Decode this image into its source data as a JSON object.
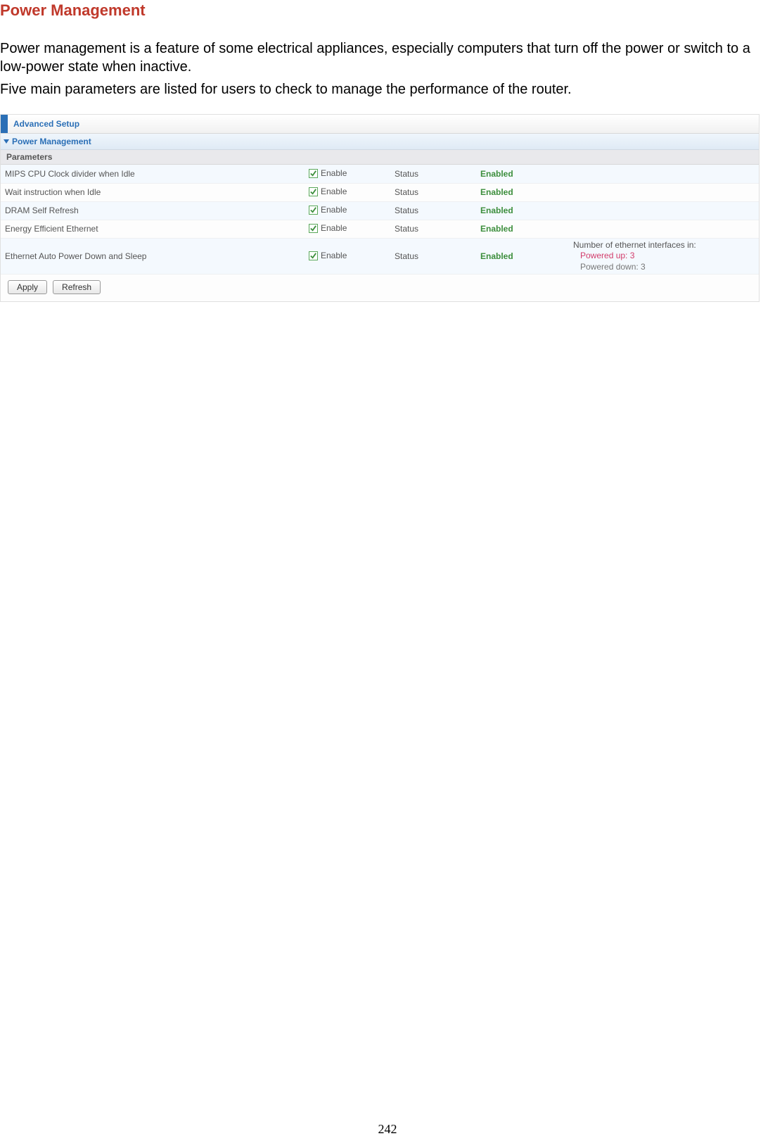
{
  "heading": "Power Management",
  "intro1": "Power management is a feature of some electrical appliances, especially computers that turn off the power or switch to a low-power state when inactive.",
  "intro2": "Five main parameters are listed for users to check to manage the performance of the router.",
  "panel": {
    "title": "Advanced Setup",
    "section": "Power Management",
    "params_header": "Parameters",
    "enable_label": "Enable",
    "status_label": "Status",
    "rows": [
      {
        "name": "MIPS CPU Clock divider when Idle",
        "value": "Enabled"
      },
      {
        "name": "Wait instruction when Idle",
        "value": "Enabled"
      },
      {
        "name": "DRAM Self Refresh",
        "value": "Enabled"
      },
      {
        "name": "Energy Efficient Ethernet",
        "value": "Enabled"
      },
      {
        "name": "Ethernet Auto Power Down and Sleep",
        "value": "Enabled",
        "extra": {
          "title": "Number of ethernet interfaces in:",
          "up": "Powered up: 3",
          "down": "Powered down: 3"
        }
      }
    ],
    "buttons": {
      "apply": "Apply",
      "refresh": "Refresh"
    }
  },
  "page_number": "242"
}
